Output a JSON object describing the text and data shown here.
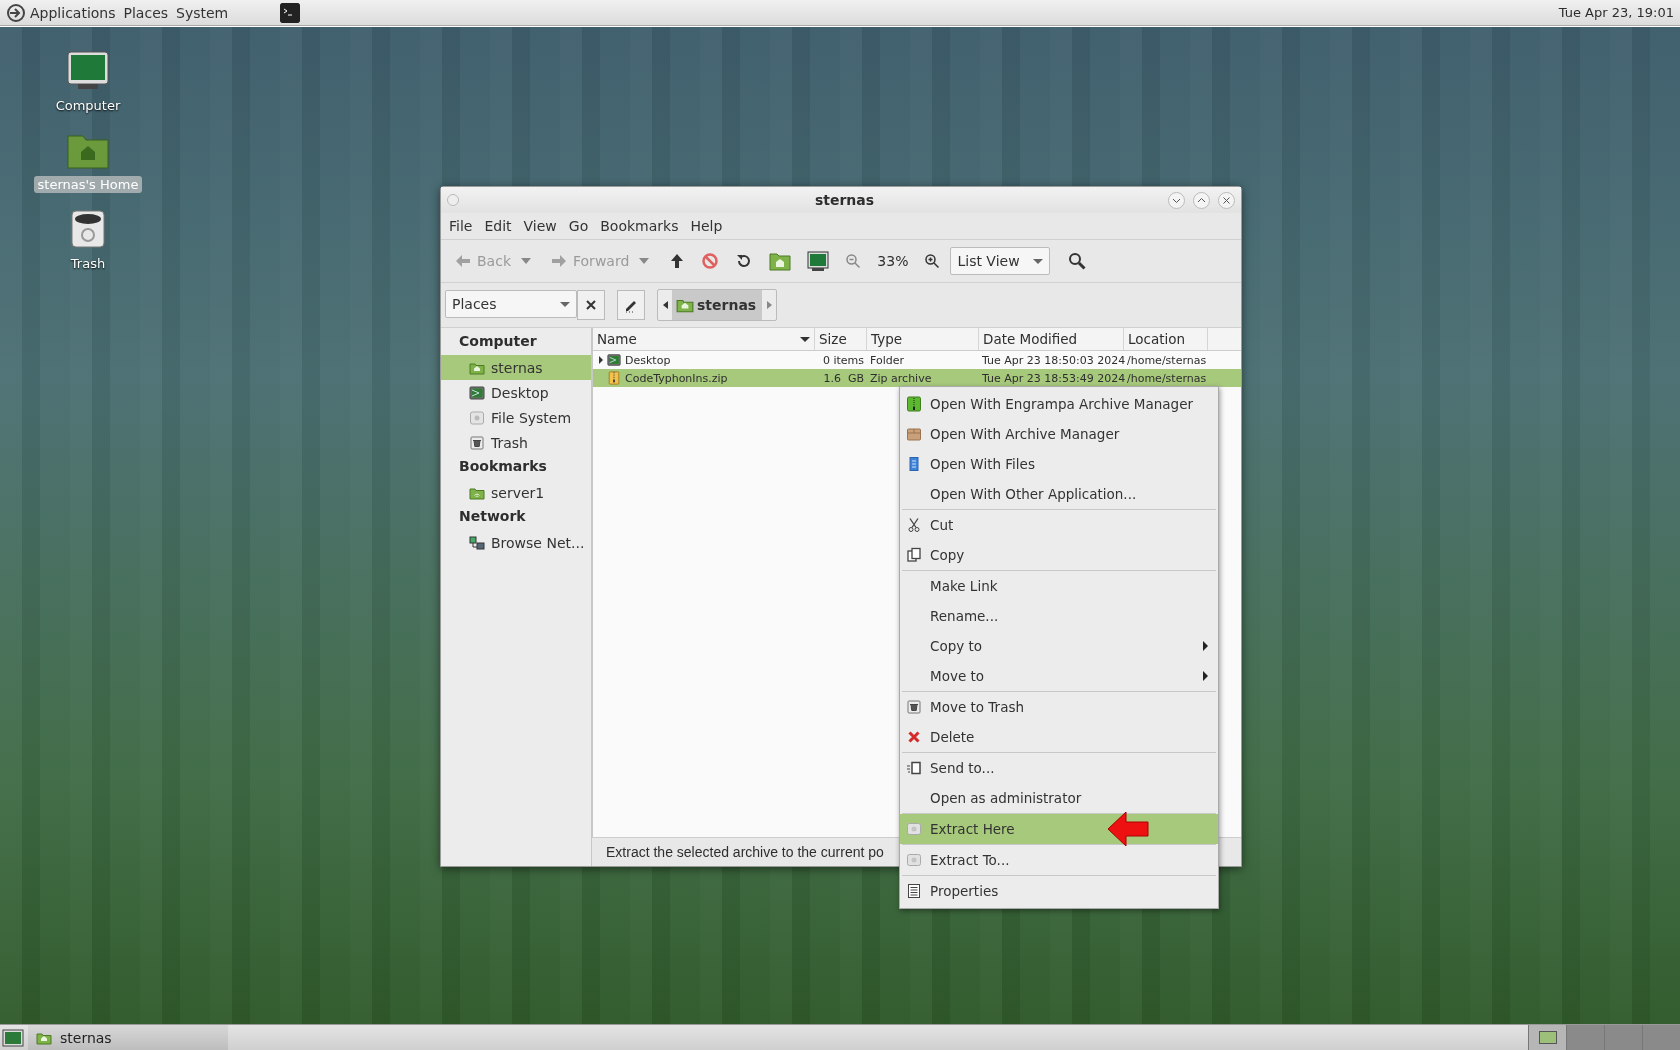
{
  "top_panel": {
    "menus": [
      "Applications",
      "Places",
      "System"
    ],
    "clock": "Tue Apr 23, 19:01"
  },
  "desktop_icons": [
    {
      "label": "Computer",
      "kind": "computer",
      "selected": false
    },
    {
      "label": "sternas's Home",
      "kind": "home",
      "selected": true
    },
    {
      "label": "Trash",
      "kind": "trash",
      "selected": false
    }
  ],
  "window": {
    "title": "sternas",
    "menu": [
      "File",
      "Edit",
      "View",
      "Go",
      "Bookmarks",
      "Help"
    ],
    "toolbar": {
      "back": {
        "label": "Back",
        "disabled": true
      },
      "forward": {
        "label": "Forward",
        "disabled": true
      },
      "zoom": "33%",
      "view": "List View"
    },
    "location": {
      "side_pane": "Places",
      "crumb": "sternas"
    },
    "sidebar": [
      {
        "heading": "Computer",
        "items": [
          {
            "label": "sternas",
            "kind": "home",
            "selected": true
          },
          {
            "label": "Desktop",
            "kind": "desktop",
            "selected": false
          },
          {
            "label": "File System",
            "kind": "drive",
            "selected": false
          },
          {
            "label": "Trash",
            "kind": "trash",
            "selected": false
          }
        ]
      },
      {
        "heading": "Bookmarks",
        "items": [
          {
            "label": "server1",
            "kind": "bookmark",
            "selected": false
          }
        ]
      },
      {
        "heading": "Network",
        "items": [
          {
            "label": "Browse Net...",
            "kind": "network",
            "selected": false
          }
        ]
      }
    ],
    "table": {
      "columns": [
        "Name",
        "Size",
        "Type",
        "Date Modified",
        "Location"
      ],
      "rows": [
        {
          "name": "Desktop",
          "size": "0 items",
          "type": "Folder",
          "modified": "Tue Apr 23 18:50:03 2024",
          "location": "/home/sternas",
          "kind": "desktop",
          "expandable": true,
          "selected": false
        },
        {
          "name": "CodeTyphonIns.zip",
          "size": "1.6  GB",
          "type": "Zip archive",
          "modified": "Tue Apr 23 18:53:49 2024",
          "location": "/home/sternas",
          "kind": "zip",
          "expandable": false,
          "selected": true
        }
      ]
    },
    "status_bar": "Extract the selected archive to the current po"
  },
  "context_menu": [
    [
      {
        "label": "Open With Engrampa Archive Manager",
        "kind": "engrampa",
        "submenu": false,
        "selected": false
      },
      {
        "label": "Open With Archive Manager",
        "kind": "package",
        "submenu": false,
        "selected": false
      },
      {
        "label": "Open With Files",
        "kind": "files",
        "submenu": false,
        "selected": false
      },
      {
        "label": "Open With Other Application...",
        "kind": "plain",
        "submenu": false,
        "selected": false
      }
    ],
    [
      {
        "label": "Cut",
        "kind": "cut",
        "submenu": false,
        "selected": false
      },
      {
        "label": "Copy",
        "kind": "copy",
        "submenu": false,
        "selected": false
      }
    ],
    [
      {
        "label": "Make Link",
        "kind": "plain",
        "submenu": false,
        "selected": false
      },
      {
        "label": "Rename...",
        "kind": "plain",
        "submenu": false,
        "selected": false
      },
      {
        "label": "Copy to",
        "kind": "plain",
        "submenu": true,
        "selected": false
      },
      {
        "label": "Move to",
        "kind": "plain",
        "submenu": true,
        "selected": false
      }
    ],
    [
      {
        "label": "Move to Trash",
        "kind": "trash",
        "submenu": false,
        "selected": false
      },
      {
        "label": "Delete",
        "kind": "delete",
        "submenu": false,
        "selected": false
      }
    ],
    [
      {
        "label": "Send to...",
        "kind": "send",
        "submenu": false,
        "selected": false
      },
      {
        "label": "Open as administrator",
        "kind": "plain",
        "submenu": false,
        "selected": false
      }
    ],
    [
      {
        "label": "Extract Here",
        "kind": "extract",
        "submenu": false,
        "selected": true
      }
    ],
    [
      {
        "label": "Extract To...",
        "kind": "extract",
        "submenu": false,
        "selected": false
      }
    ],
    [
      {
        "label": "Properties",
        "kind": "properties",
        "submenu": false,
        "selected": false
      }
    ]
  ],
  "taskbar": {
    "tasks": [
      {
        "label": "sternas"
      }
    ],
    "workspaces": [
      {
        "selected": true
      },
      {
        "selected": false
      },
      {
        "selected": false
      },
      {
        "selected": false
      }
    ]
  }
}
